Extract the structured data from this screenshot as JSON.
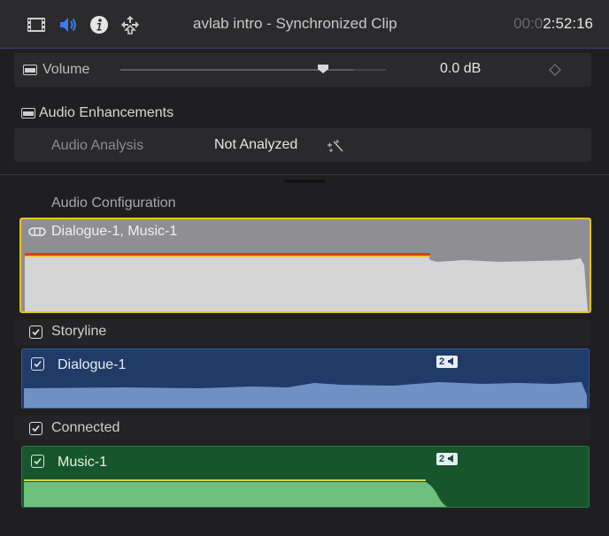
{
  "titlebar": {
    "title": "avlab intro - Synchronized Clip",
    "timecode_dim": "00:0",
    "timecode_lit": "2:52:16",
    "icons": [
      "filmstrip-icon",
      "speaker-icon",
      "info-icon",
      "share-arrows-icon"
    ],
    "accent": "#3d7bf5"
  },
  "volume": {
    "label": "Volume",
    "value": "0.0",
    "unit": "dB",
    "slider_level": 0.88
  },
  "enhancements": {
    "label": "Audio Enhancements",
    "analysis_label": "Audio Analysis",
    "analysis_value": "Not Analyzed"
  },
  "configuration": {
    "label": "Audio Configuration",
    "combined_clip": "Dialogue-1, Music-1",
    "storyline_label": "Storyline",
    "dialogue_clip": "Dialogue-1",
    "dialogue_badge": "2",
    "connected_label": "Connected",
    "music_clip": "Music-1",
    "music_badge": "2"
  },
  "colors": {
    "selection": "#e4c51d",
    "dialogue": "#213b68",
    "music": "#17552d",
    "waveform": "#d5d5d5",
    "peak_red": "#e33a1c"
  }
}
